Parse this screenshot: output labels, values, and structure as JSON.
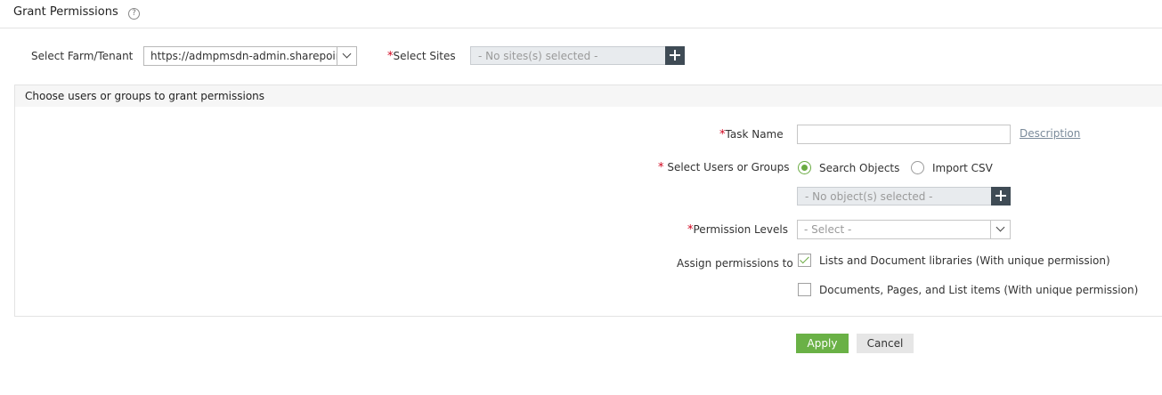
{
  "header": {
    "title": "Grant Permissions",
    "help_glyph": "?"
  },
  "top_row": {
    "farm_label": "Select Farm/Tenant",
    "farm_value": "https://admpmsdn-admin.sharepoint.com",
    "sites_required_mark": "*",
    "sites_label": "Select Sites",
    "sites_placeholder": "- No sites(s) selected -"
  },
  "panel": {
    "title": "Choose users or groups to grant permissions",
    "task_name": {
      "required_mark": "*",
      "label": "Task Name",
      "value": "",
      "description_link": "Description"
    },
    "users": {
      "required_mark": "*",
      "label": "Select Users or Groups",
      "options": [
        {
          "label": "Search Objects",
          "selected": true
        },
        {
          "label": "Import CSV",
          "selected": false
        }
      ],
      "objects_placeholder": "- No object(s) selected -"
    },
    "permission_levels": {
      "required_mark": "*",
      "label": "Permission Levels",
      "selected": "- Select -"
    },
    "assign": {
      "label": "Assign permissions to",
      "options": [
        {
          "label": "Lists and Document libraries (With unique permission)",
          "checked": true
        },
        {
          "label": "Documents, Pages, and List items (With unique permission)",
          "checked": false
        }
      ]
    }
  },
  "actions": {
    "apply": "Apply",
    "cancel": "Cancel"
  },
  "colors": {
    "accent_green": "#6ab146",
    "plus_button": "#3f4b55",
    "required": "#d0021b"
  },
  "icons": [
    "help-icon",
    "chevron-down-icon",
    "plus-icon",
    "checkmark-icon"
  ]
}
